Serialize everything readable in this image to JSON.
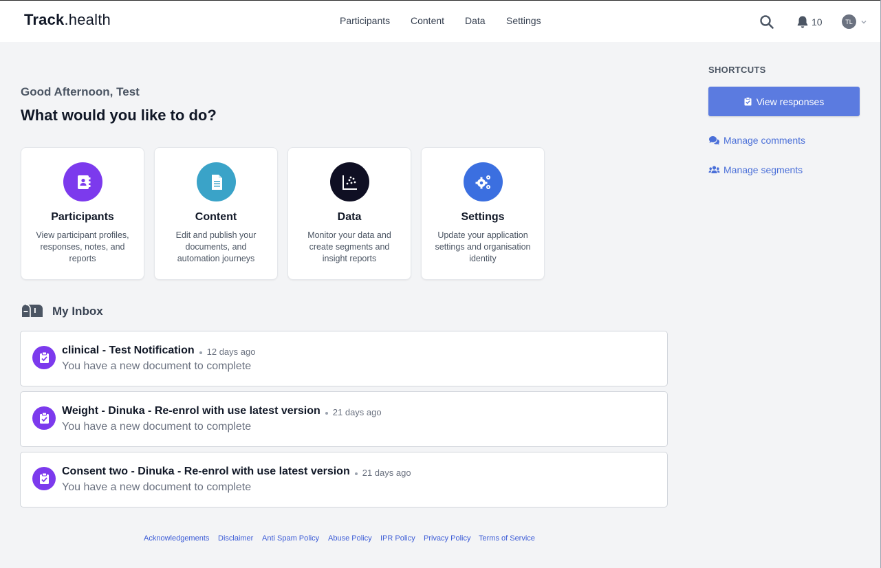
{
  "app": {
    "logo_bold": "Track",
    "logo_rest": ".health"
  },
  "nav": {
    "items": [
      {
        "label": "Participants"
      },
      {
        "label": "Content"
      },
      {
        "label": "Data"
      },
      {
        "label": "Settings"
      }
    ]
  },
  "header": {
    "notification_count": "10",
    "avatar_initials": "TL",
    "icons": [
      "search-icon",
      "bell-icon",
      "chevron-down-icon"
    ]
  },
  "greeting": {
    "line": "Good Afternoon, Test",
    "question": "What would you like to do?"
  },
  "cards": [
    {
      "title": "Participants",
      "desc": "View participant profiles, responses, notes, and reports",
      "color": "#7c3aed",
      "icon": "contacts-book-icon"
    },
    {
      "title": "Content",
      "desc": "Edit and publish your documents, and automation journeys",
      "color": "#3aa3c8",
      "icon": "document-icon"
    },
    {
      "title": "Data",
      "desc": "Monitor your data and create segments and insight reports",
      "color": "#0f0f23",
      "icon": "scatter-chart-icon"
    },
    {
      "title": "Settings",
      "desc": "Update your application settings and organisation identity",
      "color": "#3b6fe0",
      "icon": "gears-icon"
    }
  ],
  "inbox": {
    "title": "My Inbox",
    "items": [
      {
        "title": "clinical - Test Notification",
        "time": "12 days ago",
        "message": "You have a new document to complete"
      },
      {
        "title": "Weight - Dinuka - Re-enrol with use latest version",
        "time": "21 days ago",
        "message": "You have a new document to complete"
      },
      {
        "title": "Consent two - Dinuka - Re-enrol with use latest version",
        "time": "21 days ago",
        "message": "You have a new document to complete"
      }
    ]
  },
  "shortcuts": {
    "title": "SHORTCUTS",
    "primary_label": "View responses",
    "links": [
      {
        "label": "Manage comments",
        "icon": "comments-icon"
      },
      {
        "label": "Manage segments",
        "icon": "users-icon"
      }
    ]
  },
  "footer": {
    "links": [
      "Acknowledgements",
      "Disclaimer",
      "Anti Spam Policy",
      "Abuse Policy",
      "IPR Policy",
      "Privacy Policy",
      "Terms of Service"
    ]
  },
  "colors": {
    "accent": "#5b7be0",
    "link": "#4a6fd8",
    "inbox_badge": "#7c3aed",
    "background": "#f3f4f6"
  }
}
